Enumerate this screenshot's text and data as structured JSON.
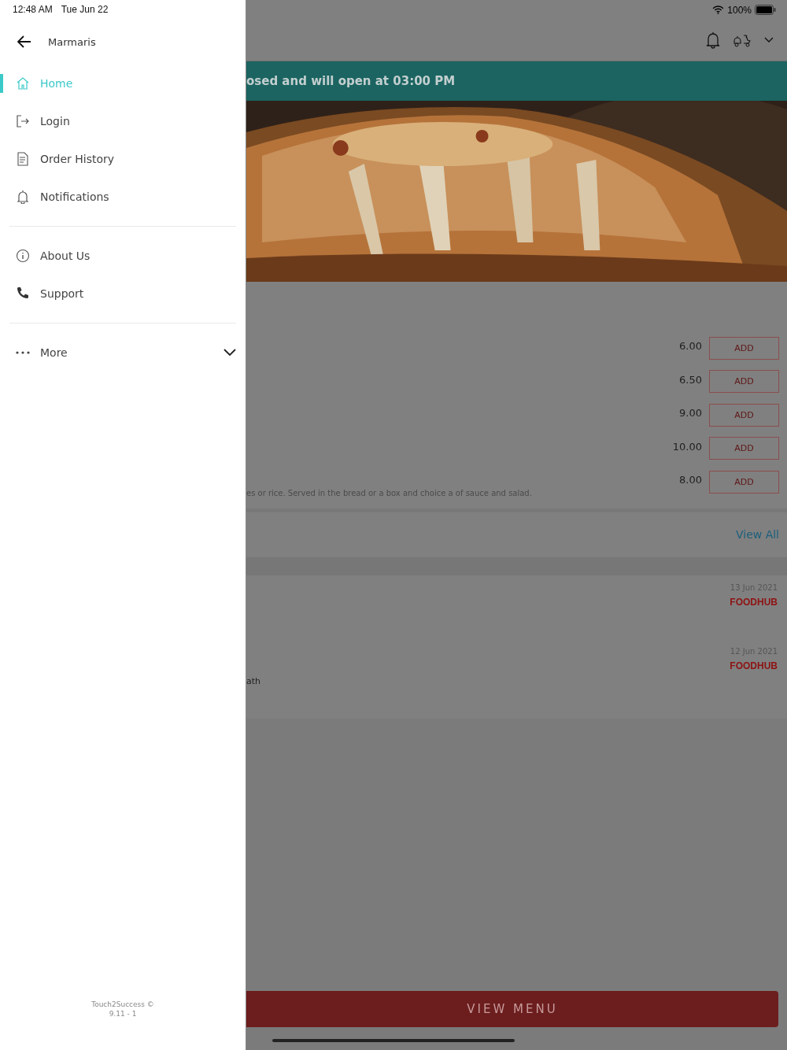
{
  "status_bar": {
    "time": "12:48 AM",
    "date": "Tue Jun 22",
    "battery": "100%"
  },
  "drawer": {
    "title": "Marmaris",
    "sections": [
      [
        {
          "label": "Home",
          "selected": true
        },
        {
          "label": "Login",
          "selected": false
        },
        {
          "label": "Order History",
          "selected": false
        },
        {
          "label": "Notifications",
          "selected": false
        }
      ],
      [
        {
          "label": "About Us",
          "selected": false
        },
        {
          "label": "Support",
          "selected": false
        }
      ]
    ],
    "more": {
      "label": "More",
      "expanded": false
    },
    "footer": [
      "Touch2Success ©",
      "9.11 - 1"
    ]
  },
  "background_page": {
    "banner": "osed and will open at 03:00 PM",
    "menu_items": [
      {
        "price": "6.00",
        "button": "ADD"
      },
      {
        "price": "6.50",
        "button": "ADD"
      },
      {
        "price": "9.00",
        "button": "ADD"
      },
      {
        "price": "10.00",
        "button": "ADD"
      },
      {
        "price": "8.00",
        "button": "ADD",
        "description": "es or rice. Served in the bread or a box and choice a of sauce and salad."
      }
    ],
    "view_all": "View All",
    "reviews": [
      {
        "date": "13 Jun 2021",
        "source": "FOODHUB"
      },
      {
        "date": "12 Jun 2021",
        "source": "FOODHUB",
        "text": "ath"
      }
    ],
    "view_menu": "VIEW MENU"
  }
}
